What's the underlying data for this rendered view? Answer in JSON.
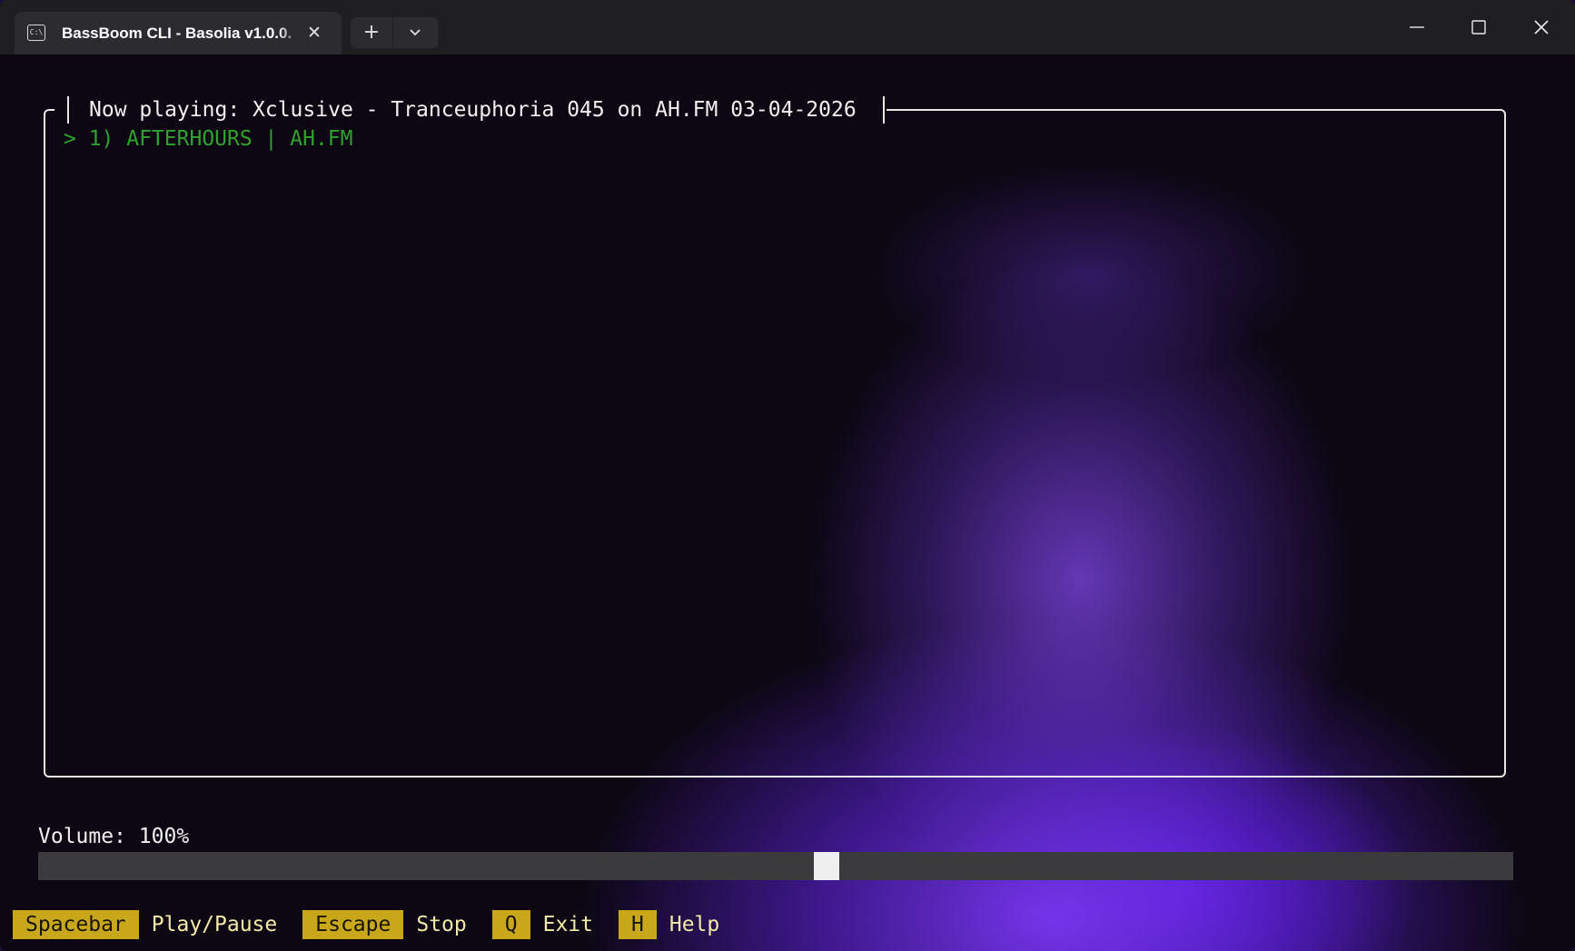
{
  "window": {
    "tab_title": "BassBoom CLI - Basolia v1.0.0.",
    "tab_icon": "terminal-icon",
    "tab_icon_glyph": "C:\\",
    "new_tab_glyph": "+",
    "tab_close_glyph": "✕"
  },
  "player": {
    "now_playing": "Now playing: Xclusive - Tranceuphoria 045 on AH.FM 03-04-2026",
    "stations": [
      {
        "label": "> 1) AFTERHOURS | AH.FM",
        "selected": true
      }
    ],
    "volume_label": "Volume: 100%",
    "volume_level": 0.535
  },
  "keybindings": [
    {
      "key": "Spacebar",
      "action": "Play/Pause"
    },
    {
      "key": "Escape",
      "action": "Stop"
    },
    {
      "key": "Q",
      "action": "Exit"
    },
    {
      "key": "H",
      "action": "Help"
    }
  ],
  "colors": {
    "accent_key_bg": "#c8a81a",
    "key_desc_text": "#f3e9a8",
    "selected_station": "#2fa12f",
    "glow_purple": "#7a3df0"
  }
}
